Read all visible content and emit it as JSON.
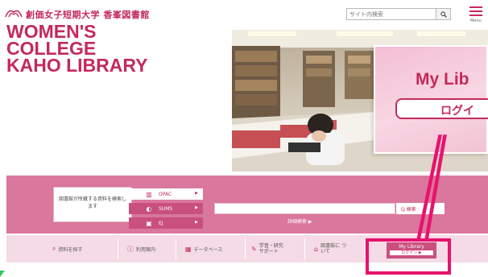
{
  "header": {
    "logo_text": "創価女子短期大学 香峯図書館",
    "search_placeholder": "サイト内検索",
    "menu_label": "Menu"
  },
  "hero": {
    "title_lines": [
      "WOMEN'S",
      "COLLEGE",
      "KAHO LIBRARY"
    ]
  },
  "mylibrary_card": {
    "title": "My Lib",
    "login_label": "ログイ"
  },
  "search_panel": {
    "description": "図書館が所蔵する資料を検索します",
    "databases": [
      {
        "label": "OPAC",
        "icon": "opac-icon"
      },
      {
        "label": "SUMS",
        "icon": "sums-icon"
      },
      {
        "label": "EJ",
        "icon": "ej-icon"
      }
    ],
    "search_button_label": "Q 検索",
    "advanced_search_label": "詳細検索 ▶"
  },
  "nav": {
    "items": [
      {
        "label": "資料を探す",
        "icon": "book-search-icon"
      },
      {
        "label": "利用案内",
        "icon": "info-icon"
      },
      {
        "label": "データベース",
        "icon": "database-icon"
      },
      {
        "label": "学習・研究 サポート",
        "icon": "pen-icon"
      },
      {
        "label": "図書館に ついて",
        "icon": "building-icon"
      }
    ],
    "mylibrary_title": "My Library",
    "mylibrary_login": "ログイン ▶"
  },
  "colors": {
    "brand": "#c4295d",
    "band": "#d9779c",
    "highlight": "#e8126e"
  }
}
